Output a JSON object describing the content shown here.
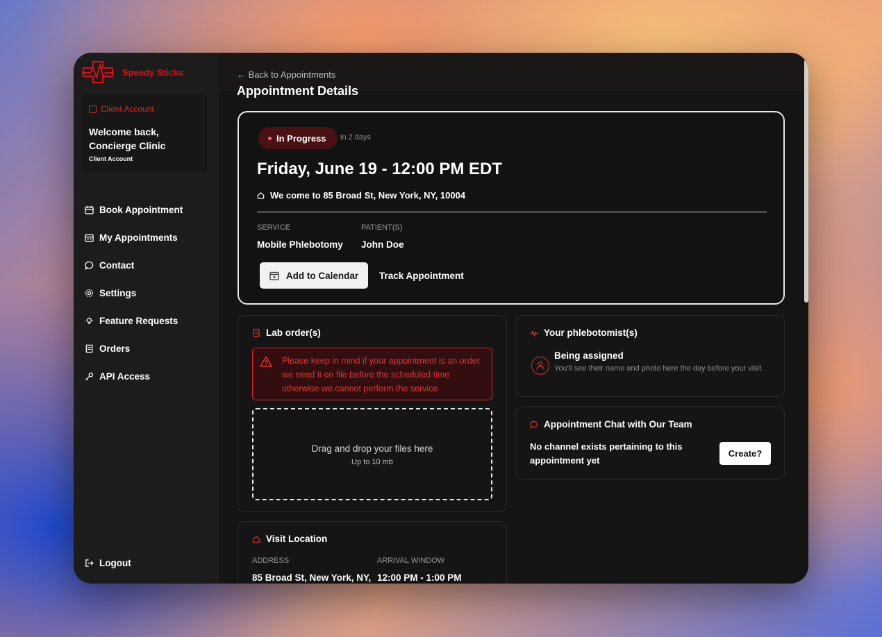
{
  "colors": {
    "brand": "#d3121a",
    "accent_dark": "#4a1114",
    "warning": "#e5332f",
    "panel_bg": "#151515",
    "sidebar_bg": "#1c1c1c"
  },
  "brand": {
    "name": "Speedy Sticks",
    "logo_icon": "heartbeat-cross-icon"
  },
  "account": {
    "kicker": "Client Account",
    "welcome": "Welcome back, Concierge Clinic",
    "subtitle": "Client Account"
  },
  "nav": [
    {
      "label": "Book Appointment",
      "icon": "calendar-icon"
    },
    {
      "label": "My Appointments",
      "icon": "calendar-icon"
    },
    {
      "label": "Contact",
      "icon": "chat-bubble-icon"
    },
    {
      "label": "Settings",
      "icon": "gear-icon"
    },
    {
      "label": "Feature Requests",
      "icon": "lightbulb-icon"
    },
    {
      "label": "Orders",
      "icon": "receipt-icon"
    },
    {
      "label": "API Access",
      "icon": "key-icon"
    }
  ],
  "logout_label": "Logout",
  "header": {
    "back_link": "← Back to Appointments",
    "title": "Appointment Details"
  },
  "appointment": {
    "status": "In Progress",
    "relative_time": "in 2 days",
    "datetime": "Friday, June 19 - 12:00 PM EDT",
    "address_line": "We come to 85 Broad St, New York, NY, 10004",
    "service_label": "SERVICE",
    "service_value": "Mobile Phlebotomy",
    "patients_label": "PATIENT(S)",
    "patients_value": "John Doe",
    "add_calendar_label": "Add to Calendar",
    "track_label": "Track Appointment"
  },
  "lab_orders": {
    "title": "Lab order(s)",
    "warning": "Please keep in mind if your appointment is an order we need it on file before the scheduled time otherwise we cannot perform the service",
    "drop_main": "Drag and drop your files here",
    "drop_sub": "Up to 10 mb"
  },
  "visit_location": {
    "title": "Visit Location",
    "address_label": "ADDRESS",
    "address_value": "85 Broad St, New York, NY,",
    "arrival_label": "ARRIVAL WINDOW",
    "arrival_value": "12:00 PM - 1:00 PM"
  },
  "phlebotomist": {
    "title": "Your phlebotomist(s)",
    "status": "Being assigned",
    "note": "You'll see their name and photo here the day before your visit."
  },
  "chat": {
    "title": "Appointment Chat with Our Team",
    "text": "No channel exists pertaining to this appointment yet",
    "create_label": "Create?"
  }
}
